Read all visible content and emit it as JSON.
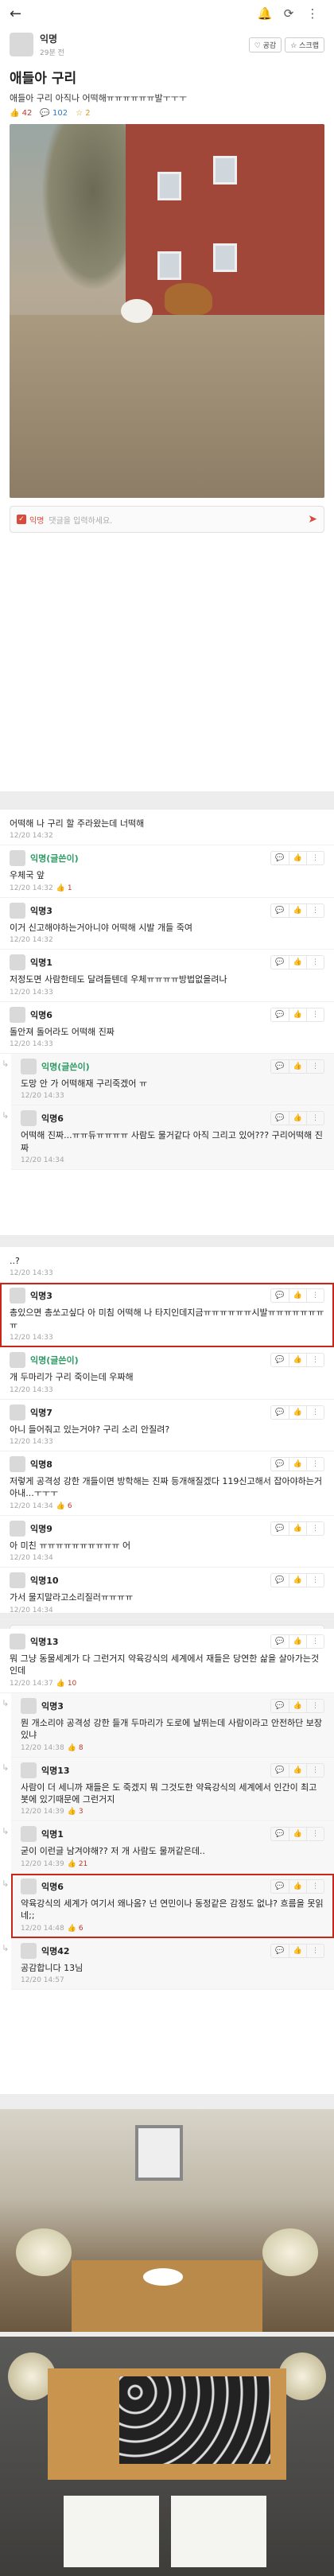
{
  "topbar": {
    "back_icon": "arrow-left-icon",
    "icons": [
      "bell-icon",
      "refresh-icon",
      "more-icon"
    ]
  },
  "post": {
    "author": "익명",
    "time": "29분 전",
    "empathy_label": "♡ 공감",
    "scrap_label": "☆ 스크랩",
    "title": "애들아 구리",
    "body": "애들아 구리 아직나 어떡해ㅠㅠㅠㅠㅠㅠ발ㅜㅜㅜ",
    "likes": "42",
    "comments": "102",
    "scraps": "2"
  },
  "comment_input": {
    "anon_label": "익명",
    "placeholder": "댓글을 입력하세요."
  },
  "section1": {
    "top_text": "어떡해 나 구리 할 주라왔는데 너떡해",
    "top_meta": "12/20 14:32",
    "comments": [
      {
        "name": "익명(글쓴이)",
        "writer": true,
        "reply": false,
        "text": "우체국 앞",
        "meta": "12/20 14:32",
        "likes": "1"
      },
      {
        "name": "익명3",
        "writer": false,
        "reply": false,
        "text": "이거 신고해야하는거아니야 어떡해 시발 개들 죽여",
        "meta": "12/20 14:32",
        "likes": ""
      },
      {
        "name": "익명1",
        "writer": false,
        "reply": false,
        "text": "저정도면 사람한테도 달려들텐데 우체ㅠㅠㅠㅠ방법없을려나",
        "meta": "12/20 14:33",
        "likes": ""
      },
      {
        "name": "익명6",
        "writer": false,
        "reply": false,
        "text": "돌안져 돌어라도 어떡해 진짜",
        "meta": "12/20 14:33",
        "likes": ""
      },
      {
        "name": "익명(글쓴이)",
        "writer": true,
        "reply": true,
        "text": "도망 안 가 어떡해재 구리죽겠어 ㅠ",
        "meta": "12/20 14:33",
        "likes": ""
      },
      {
        "name": "익명6",
        "writer": false,
        "reply": true,
        "text": "어떡해 진짜...ㅠㅠ듀ㅠㅠㅠㅠ 사람도 물거같다 아직 그리고 있어??? 구리어떡해 진짜",
        "meta": "12/20 14:34",
        "likes": ""
      }
    ]
  },
  "section2": {
    "top_text": "..?",
    "top_meta": "12/20 14:33",
    "comments": [
      {
        "name": "익명3",
        "writer": false,
        "reply": false,
        "hl": true,
        "text": "총있으면 총쏘고싶다 아 미침 어떡해 나 타지인데지금ㅠㅠㅠㅠㅠㅠ시발ㅠㅠㅠㅠㅠㅠㅠㅠ",
        "meta": "12/20 14:33",
        "likes": ""
      },
      {
        "name": "익명(글쓴이)",
        "writer": true,
        "reply": false,
        "text": "개 두마리가 구리 죽이는데 우짜해",
        "meta": "12/20 14:33",
        "likes": ""
      },
      {
        "name": "익명7",
        "writer": false,
        "reply": false,
        "text": "아니 들어줘고 있는거야? 구리 소리 안질려?",
        "meta": "12/20 14:33",
        "likes": ""
      },
      {
        "name": "익명8",
        "writer": false,
        "reply": false,
        "text": "저렇게 공격성 강한 개들이면 방학해는 진짜 등개해질겠다 119신고해서 잡아야하는거아내...ㅜㅜㅜ",
        "meta": "12/20 14:34",
        "likes": "6"
      },
      {
        "name": "익명9",
        "writer": false,
        "reply": false,
        "text": "아 미친 ㅠㅠㅠㅠㅠㅠㅠㅠㅠㅠ 어",
        "meta": "12/20 14:34",
        "likes": ""
      },
      {
        "name": "익명10",
        "writer": false,
        "reply": false,
        "text": "가서 물지말라고소리질러ㅠㅠㅠㅠ",
        "meta": "12/20 14:34",
        "likes": ""
      }
    ]
  },
  "section3": {
    "top_name": "익명13",
    "top_text": "뭐 그냥 동물세계가 다 그런거지 약육강식의 세계에서 재들은 당연한 삶을 살아가는것인데",
    "top_meta": "12/20 14:37",
    "top_likes": "10",
    "comments": [
      {
        "name": "익명3",
        "writer": false,
        "reply": true,
        "text": "뭔 개소리야 공격성 강한 들개 두마리가 도로에 날뛰는데 사람이라고 안전하단 보장있냐",
        "meta": "12/20 14:38",
        "likes": "8"
      },
      {
        "name": "익명13",
        "writer": false,
        "reply": true,
        "text": "사람이 더 세니까 재들은 도 죽겠지 뭐 그것도한 약육강식의 세계에서 인간이 최고봇에 있기때문에 그런거지",
        "meta": "12/20 14:39",
        "likes": "3"
      },
      {
        "name": "익명1",
        "writer": false,
        "reply": true,
        "text": "굳이 이런글 남겨야해?? 저 개 사람도 물꺼같은데..",
        "meta": "12/20 14:39",
        "likes": "21"
      },
      {
        "name": "익명6",
        "writer": false,
        "reply": true,
        "hl": true,
        "text": "약육강식의 세계가 여기서 왜나옴? 넌 연민이나 동정같은 감정도 없냐? 흐름을 못읽네;;",
        "meta": "12/20 14:48",
        "likes": "6"
      },
      {
        "name": "익명42",
        "writer": false,
        "reply": true,
        "text": "공감합니다 13님",
        "meta": "12/20 14:57",
        "likes": ""
      }
    ]
  }
}
